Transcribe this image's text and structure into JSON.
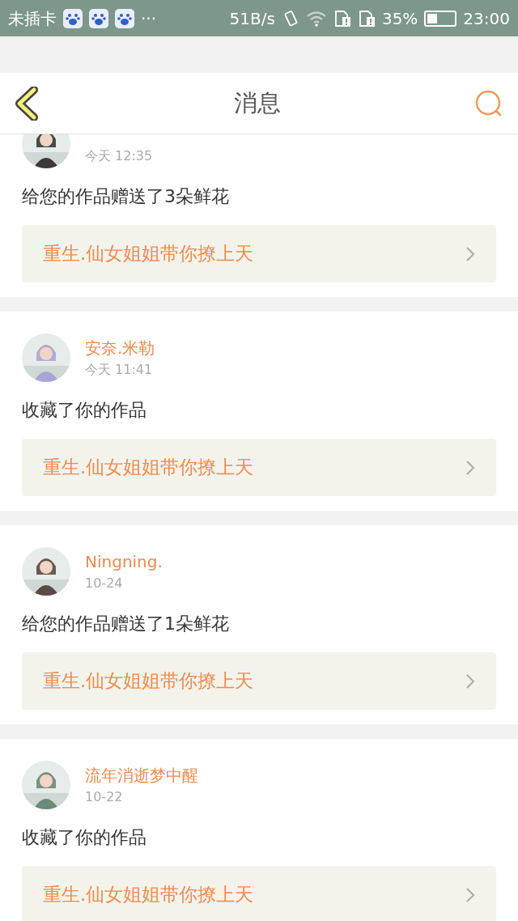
{
  "status_bar": {
    "carrier": "未插卡",
    "more": "···",
    "speed": "51B/s",
    "battery_percent": "35%",
    "time": "23:00"
  },
  "header": {
    "title": "消息"
  },
  "messages": [
    {
      "time": "今天 12:35",
      "text": "给您的作品赠送了3朵鲜花",
      "work": "重生.仙女姐姐带你撩上天"
    },
    {
      "name": "安奈.米勒",
      "time": "今天 11:41",
      "text": "收藏了你的作品",
      "work": "重生.仙女姐姐带你撩上天"
    },
    {
      "name": "Ningning.",
      "time": "10-24",
      "text": "给您的作品赠送了1朵鲜花",
      "work": "重生.仙女姐姐带你撩上天"
    },
    {
      "name": "流年消逝梦中醒",
      "time": "10-22",
      "text": "收藏了你的作品",
      "work": "重生.仙女姐姐带你撩上天"
    }
  ]
}
